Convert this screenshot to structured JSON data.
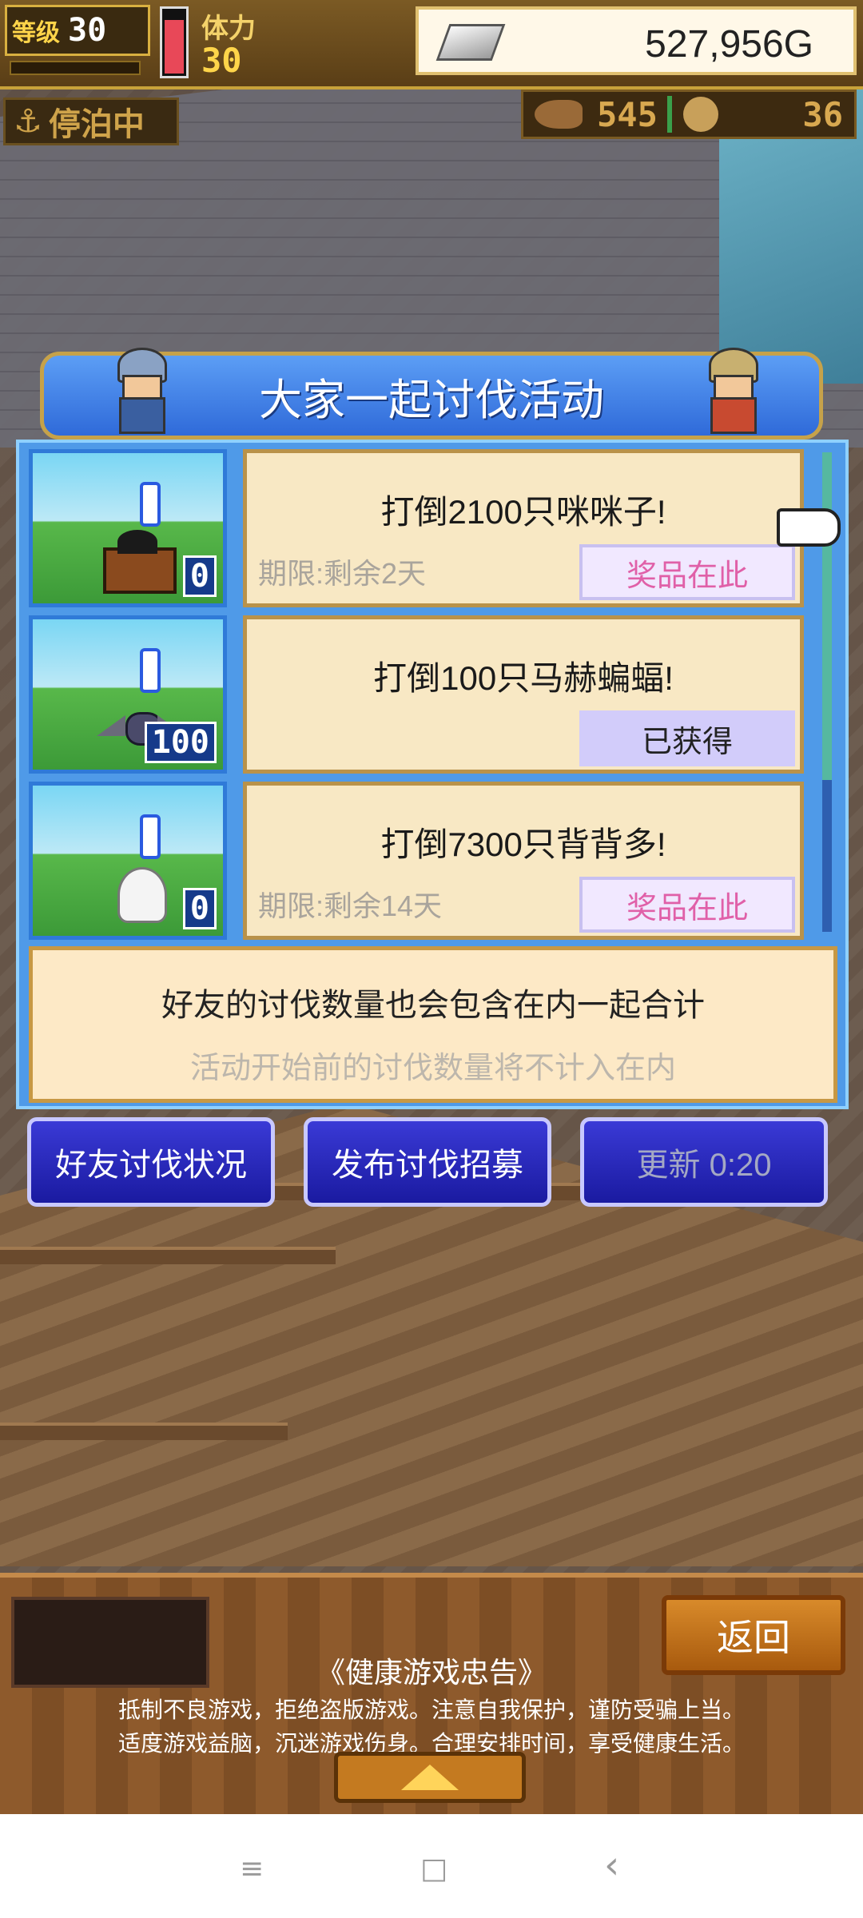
{
  "status": {
    "level_label": "等级",
    "level": "30",
    "stamina_label": "体力",
    "stamina": "30",
    "gold": "527,956G",
    "docked": "停泊中",
    "food": "545",
    "medals": "36"
  },
  "event": {
    "title": "大家一起讨伐活动",
    "items": [
      {
        "title": "打倒2100只咪咪子!",
        "deadline": "期限:剩余2天",
        "action": "奖品在此",
        "count": "0",
        "state": "prize"
      },
      {
        "title": "打倒100只马赫蝙蝠!",
        "deadline": "",
        "action": "已获得",
        "count": "100",
        "state": "obtained"
      },
      {
        "title": "打倒7300只背背多!",
        "deadline": "期限:剩余14天",
        "action": "奖品在此",
        "count": "0",
        "state": "prize"
      }
    ],
    "info_line1": "好友的讨伐数量也会包含在内一起合计",
    "info_line2": "活动开始前的讨伐数量将不计入在内",
    "buttons": {
      "friends": "好友讨伐状况",
      "recruit": "发布讨伐招募",
      "refresh": "更新 0:20"
    }
  },
  "bottom": {
    "back": "返回",
    "advice_title": "《健康游戏忠告》",
    "advice_line1": "抵制不良游戏，拒绝盗版游戏。注意自我保护，谨防受骗上当。",
    "advice_line2": "适度游戏益脑，沉迷游戏伤身。合理安排时间，享受健康生活。"
  },
  "navbar": {
    "menu": "≡",
    "home": "□",
    "back": "‹"
  }
}
